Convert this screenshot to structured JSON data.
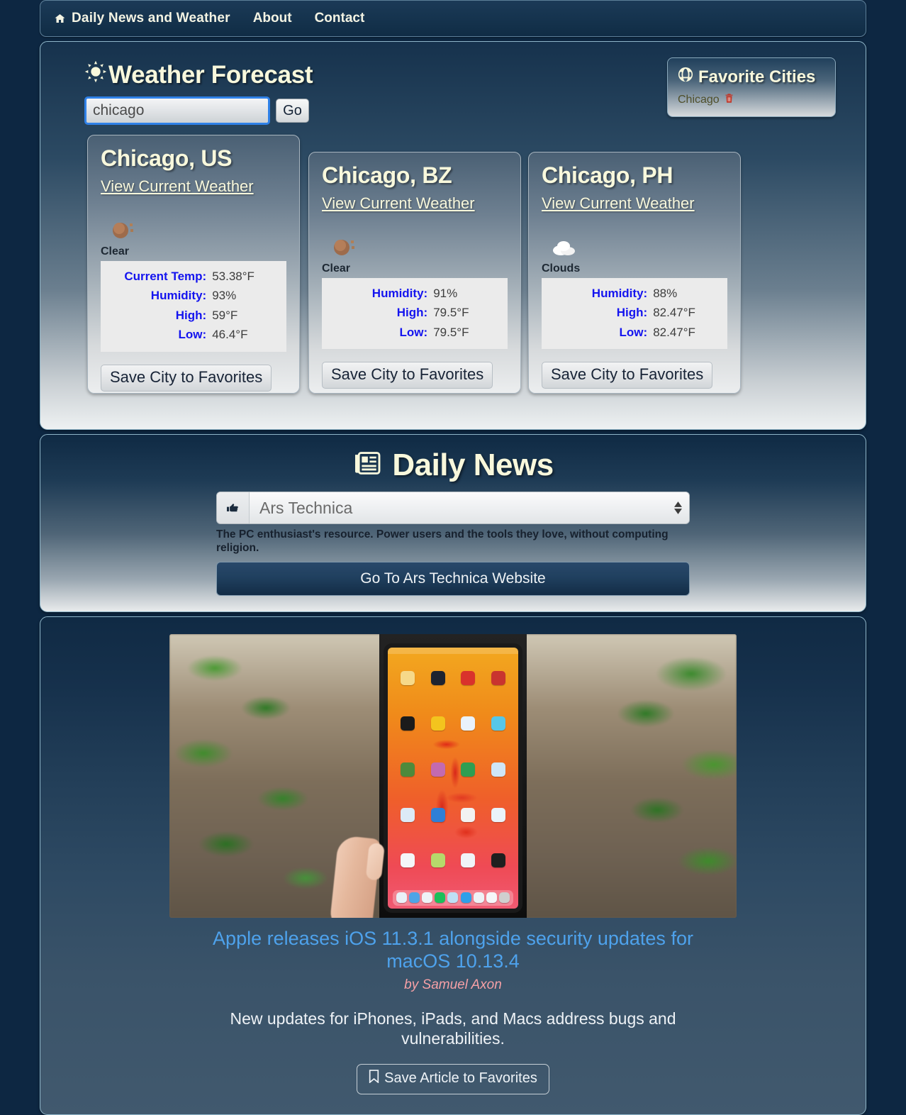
{
  "nav": {
    "brand": "Daily News and Weather",
    "links": [
      "About",
      "Contact"
    ]
  },
  "weather": {
    "title": "Weather Forecast",
    "search_value": "chicago",
    "search_placeholder": "",
    "go_label": "Go",
    "favorites": {
      "title": "Favorite Cities",
      "cities": [
        "Chicago"
      ]
    },
    "cards": [
      {
        "city": "Chicago, US",
        "link_label": "View Current Weather",
        "icon": "sun-icon",
        "condition": "Clear",
        "stats": [
          {
            "label": "Current Temp:",
            "value": "53.38°F"
          },
          {
            "label": "Humidity:",
            "value": "93%"
          },
          {
            "label": "High:",
            "value": "59°F"
          },
          {
            "label": "Low:",
            "value": "46.4°F"
          }
        ],
        "save_label": "Save City to Favorites"
      },
      {
        "city": "Chicago, BZ",
        "link_label": "View Current Weather",
        "icon": "sun-icon",
        "condition": "Clear",
        "stats": [
          {
            "label": "Humidity:",
            "value": "91%"
          },
          {
            "label": "High:",
            "value": "79.5°F"
          },
          {
            "label": "Low:",
            "value": "79.5°F"
          }
        ],
        "save_label": "Save City to Favorites"
      },
      {
        "city": "Chicago, PH",
        "link_label": "View Current Weather",
        "icon": "cloud-icon",
        "condition": "Clouds",
        "stats": [
          {
            "label": "Humidity:",
            "value": "88%"
          },
          {
            "label": "High:",
            "value": "82.47°F"
          },
          {
            "label": "Low:",
            "value": "82.47°F"
          }
        ],
        "save_label": "Save City to Favorites"
      }
    ]
  },
  "news": {
    "title": "Daily News",
    "selected_source": "Ars Technica",
    "description": "The PC enthusiast's resource. Power users and the tools they love, without computing religion.",
    "go_site_label": "Go To Ars Technica Website"
  },
  "article": {
    "title": "Apple releases iOS 11.3.1 alongside security updates for macOS 10.13.4",
    "author": "by Samuel Axon",
    "description": "New updates for iPhones, iPads, and Macs address bugs and vulnerabilities.",
    "save_label": "Save Article to Favorites"
  },
  "colors": {
    "page_background": "#0d2742",
    "heading_cream": "#f8f8dc",
    "stat_label_blue": "#1414ef",
    "article_link_blue": "#4ea2ec",
    "author_pink": "#f5a0a6",
    "favorite_city_text": "#4f4f2a",
    "trash_red": "#c0392b"
  }
}
